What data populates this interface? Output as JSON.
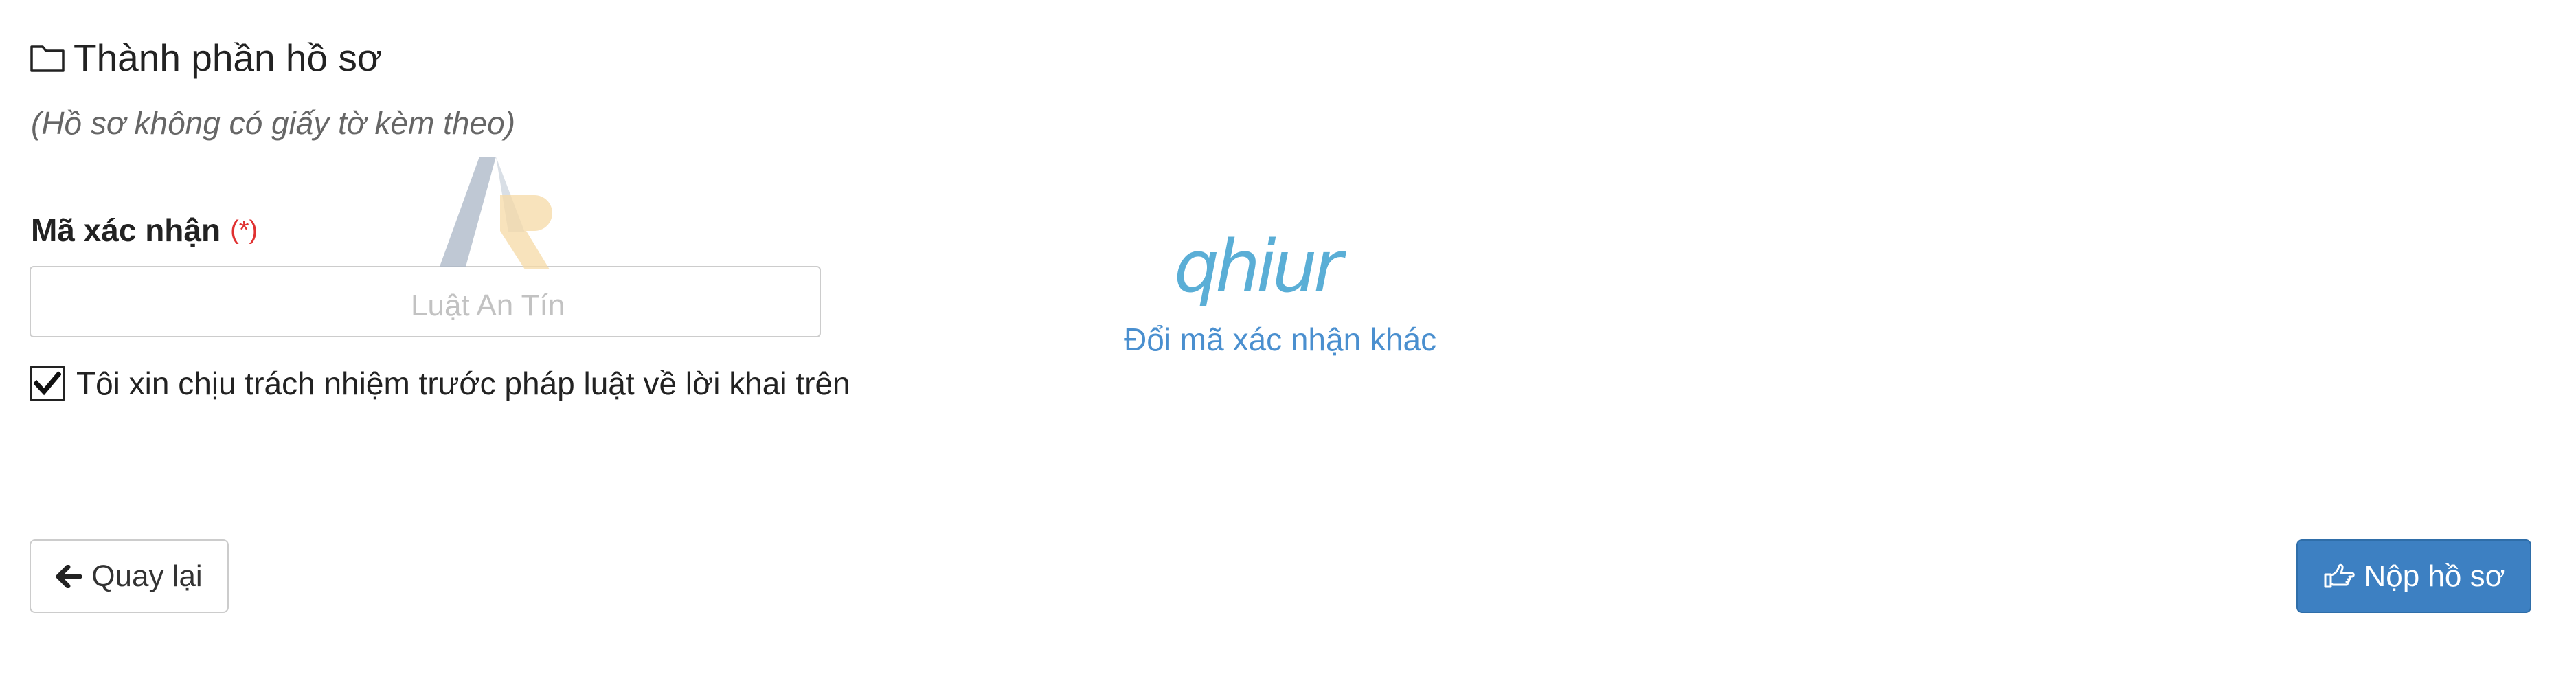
{
  "section": {
    "icon": "folder-open-outline-icon",
    "title": "Thành phần hồ sơ",
    "subtitle": "(Hồ sơ không có giấy tờ kèm theo)"
  },
  "captcha": {
    "label": "Mã xác nhận",
    "required_mark": "(*)",
    "input_value": "",
    "code": "qhiur",
    "refresh_link": "Đổi mã xác nhận khác",
    "code_color": "#5aaed6"
  },
  "watermark": {
    "text": "Luật An Tín"
  },
  "declaration": {
    "checked": true,
    "label": "Tôi xin chịu trách nhiệm trước pháp luật về lời khai trên"
  },
  "actions": {
    "back_icon": "arrow-left-icon",
    "back_label": "Quay lại",
    "submit_icon": "hand-pointing-right-icon",
    "submit_label": "Nộp hồ sơ",
    "submit_color": "#3d80c2"
  }
}
